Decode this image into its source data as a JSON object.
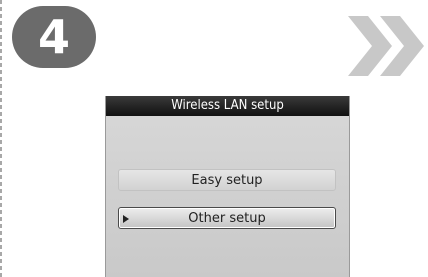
{
  "step": {
    "number": "4"
  },
  "screen": {
    "title": "Wireless LAN setup",
    "items": [
      {
        "label": "Easy setup",
        "selected": false
      },
      {
        "label": "Other setup",
        "selected": true
      }
    ]
  },
  "colors": {
    "badge": "#6b6b6b",
    "chevrons": "#c8c8c8",
    "title_bar": "#111111",
    "screen_bg": "#d0d0d0"
  }
}
